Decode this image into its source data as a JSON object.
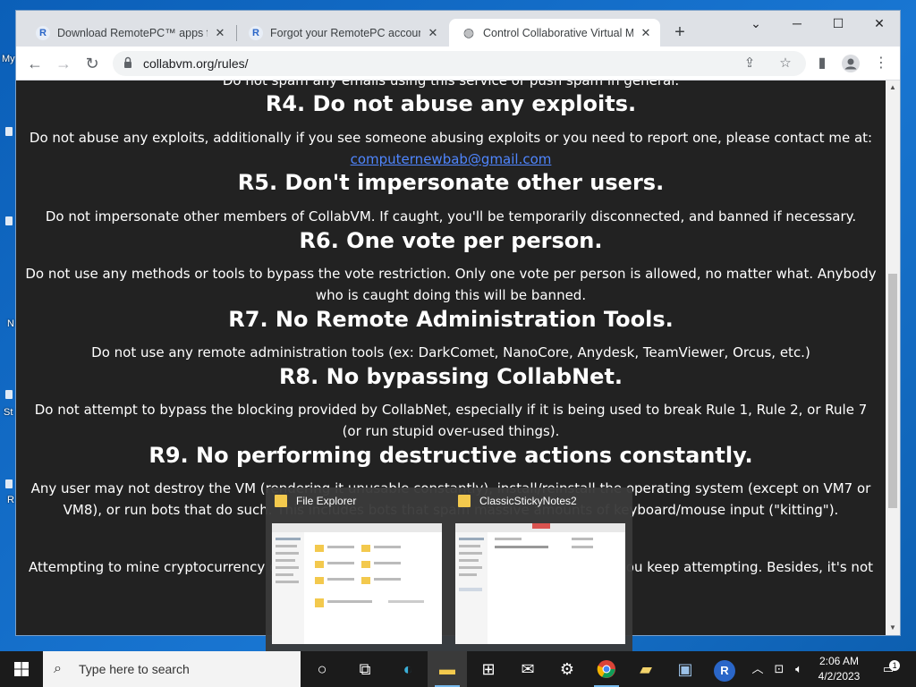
{
  "desktop": {
    "icon_labels": [
      "My",
      "N",
      "St",
      "R"
    ]
  },
  "browser": {
    "tabs": [
      {
        "title": "Download RemotePC™ apps for",
        "favicon": "R"
      },
      {
        "title": "Forgot your RemotePC account p",
        "favicon": "R"
      },
      {
        "title": "Control Collaborative Virtual Ma",
        "favicon": "globe-icon"
      }
    ],
    "url": "collabvm.org/rules/"
  },
  "page": {
    "top_cut_text": "Do not spam any emails using this service or push spam in general.",
    "rules": [
      {
        "heading": "R4. Do not abuse any exploits.",
        "body": "Do not abuse any exploits, additionally if you see someone abusing exploits or you need to report one, please contact me at:",
        "link": "computernewbab@gmail.com"
      },
      {
        "heading": "R5. Don't impersonate other users.",
        "body": "Do not impersonate other members of CollabVM. If caught, you'll be temporarily disconnected, and banned if necessary."
      },
      {
        "heading": "R6. One vote per person.",
        "body": "Do not use any methods or tools to bypass the vote restriction. Only one vote per person is allowed, no matter what. Anybody who is caught doing this will be banned."
      },
      {
        "heading": "R7. No Remote Administration Tools.",
        "body": "Do not use any remote administration tools (ex: DarkComet, NanoCore, Anydesk, TeamViewer, Orcus, etc.)"
      },
      {
        "heading": "R8. No bypassing CollabNet.",
        "body": "Do not attempt to bypass the blocking provided by CollabNet, especially if it is being used to break Rule 1, Rule 2, or Rule 7 (or run stupid over-used things)."
      },
      {
        "heading": "R9. No performing destructive actions constantly.",
        "body": "Any user may not destroy the VM (rendering it unusable constantly), install/reinstall the operating system (except on VM7 or VM8), or run bots that do such. This includes bots that spam massive amounts of keyboard/mouse input (\"kitting\")."
      }
    ],
    "partial_line_left": "Attempting to mine cryptocurrency on",
    "partial_line_right": "if you keep attempting. Besides, it's not"
  },
  "preview": {
    "items": [
      "File Explorer",
      "ClassicStickyNotes2"
    ]
  },
  "taskbar": {
    "search_placeholder": "Type here to search",
    "time": "2:06 AM",
    "date": "4/2/2023",
    "notification_count": "1"
  }
}
